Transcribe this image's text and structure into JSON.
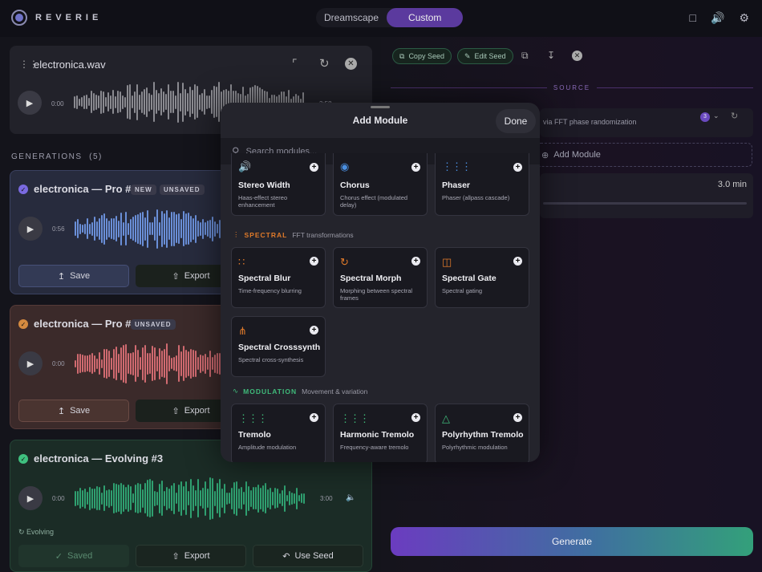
{
  "app": {
    "brand": "REVERIE",
    "tabs": [
      "Dreamscape",
      "Custom"
    ],
    "active_tab": "Custom",
    "icons": [
      "clipboard-icon",
      "speaker-icon",
      "gear-icon"
    ]
  },
  "source_file": {
    "name": "electronica.wav",
    "time": "0:00",
    "duration": "3:58"
  },
  "generations": {
    "label": "GENERATIONS",
    "count": "(5)",
    "items": [
      {
        "title": "electronica — Pro #5",
        "badges": [
          "NEW",
          "UNSAVED"
        ],
        "time": "0:56",
        "buttons": [
          "Save",
          "Export"
        ],
        "color": "#6a8fd8"
      },
      {
        "title": "electronica — Pro #4",
        "badges": [
          "UNSAVED"
        ],
        "time": "0:00",
        "buttons": [
          "Save",
          "Export"
        ],
        "color": "#d06a70"
      },
      {
        "title": "electronica — Evolving #3",
        "badges": [],
        "time": "0:00",
        "duration": "3:00",
        "status": "Evolving",
        "buttons": [
          "Saved",
          "Export",
          "Use Seed"
        ],
        "color": "#2fa070"
      }
    ]
  },
  "right": {
    "copy_seed": "Copy Seed",
    "edit_seed": "Edit Seed",
    "source_label": "SOURCE",
    "source_desc": "via FFT phase randomization",
    "source_badge": "3",
    "add_module": "Add Module",
    "duration": "3.0 min",
    "generate": "Generate"
  },
  "modal": {
    "title": "Add Module",
    "done": "Done",
    "search_placeholder": "Search modules...",
    "sections": [
      {
        "name": "SPECTRAL",
        "desc": "FFT transformations",
        "color": "#e07a2a"
      },
      {
        "name": "MODULATION",
        "desc": "Movement & variation",
        "color": "#3fba7a"
      }
    ],
    "modules_top": [
      {
        "name": "Stereo Width",
        "desc": "Haas-effect stereo enhancement",
        "icon": "speaker-icon",
        "color": "#4a8fe0"
      },
      {
        "name": "Chorus",
        "desc": "Chorus effect (modulated delay)",
        "icon": "chorus-icon",
        "color": "#4a8fe0"
      },
      {
        "name": "Phaser",
        "desc": "Phaser (allpass cascade)",
        "icon": "waveform-icon",
        "color": "#4a8fe0"
      }
    ],
    "modules_spectral": [
      {
        "name": "Spectral Blur",
        "desc": "Time-frequency blurring",
        "icon": "dots-icon",
        "color": "#e07a2a"
      },
      {
        "name": "Spectral Morph",
        "desc": "Morphing between spectral frames",
        "icon": "morph-icon",
        "color": "#e07a2a"
      },
      {
        "name": "Spectral Gate",
        "desc": "Spectral gating",
        "icon": "gate-icon",
        "color": "#e07a2a"
      },
      {
        "name": "Spectral Crosssynth",
        "desc": "Spectral cross-synthesis",
        "icon": "merge-icon",
        "color": "#e07a2a"
      }
    ],
    "modules_modulation": [
      {
        "name": "Tremolo",
        "desc": "Amplitude modulation",
        "icon": "waveform-icon",
        "color": "#3fba7a"
      },
      {
        "name": "Harmonic Tremolo",
        "desc": "Frequency-aware tremolo",
        "icon": "waveform-icon",
        "color": "#3fba7a"
      },
      {
        "name": "Polyrhythm Tremolo",
        "desc": "Polyrhythmic modulation",
        "icon": "triangle-icon",
        "color": "#3fba7a"
      }
    ]
  }
}
